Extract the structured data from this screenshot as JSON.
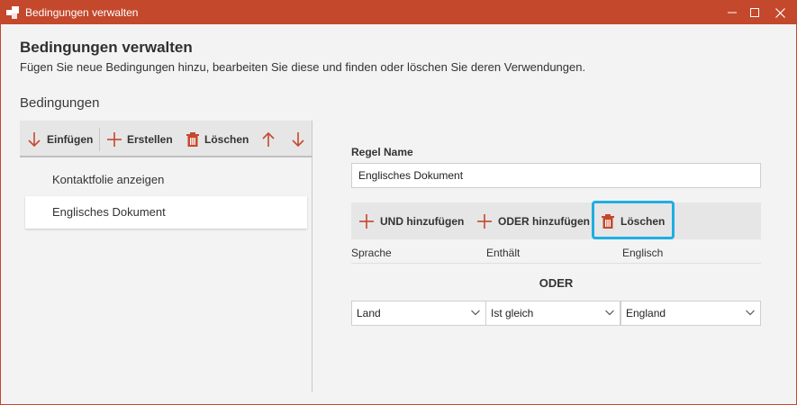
{
  "window": {
    "title": "Bedingungen verwalten",
    "accent_color": "#c4482c",
    "highlight_color": "#1faee3",
    "icons": {
      "app": "app-icon",
      "minimize": "minimize-icon",
      "maximize": "maximize-icon",
      "close": "close-icon"
    }
  },
  "header": {
    "title": "Bedingungen verwalten",
    "subtitle": "Fügen Sie neue Bedingungen hinzu, bearbeiten Sie diese und finden oder löschen Sie deren Verwendungen."
  },
  "conditions": {
    "section_label": "Bedingungen",
    "toolbar": {
      "insert_label": "Einfügen",
      "create_label": "Erstellen",
      "delete_label": "Löschen",
      "icons": [
        "arrow-down-icon",
        "plus-icon",
        "trash-icon",
        "arrow-up-icon",
        "arrow-down-icon"
      ]
    },
    "items": [
      {
        "label": "Kontaktfolie anzeigen",
        "selected": false
      },
      {
        "label": "Englisches Dokument",
        "selected": true
      }
    ]
  },
  "rule": {
    "name_label": "Regel Name",
    "name_value": "Englisches Dokument",
    "toolbar": {
      "and_label": "UND hinzufügen",
      "or_label": "ODER hinzufügen",
      "delete_label": "Löschen"
    },
    "row1": {
      "field": "Sprache",
      "operator": "Enthält",
      "value": "Englisch"
    },
    "or_label": "ODER",
    "row2": {
      "field": "Land",
      "operator": "Ist gleich",
      "value": "England"
    }
  }
}
